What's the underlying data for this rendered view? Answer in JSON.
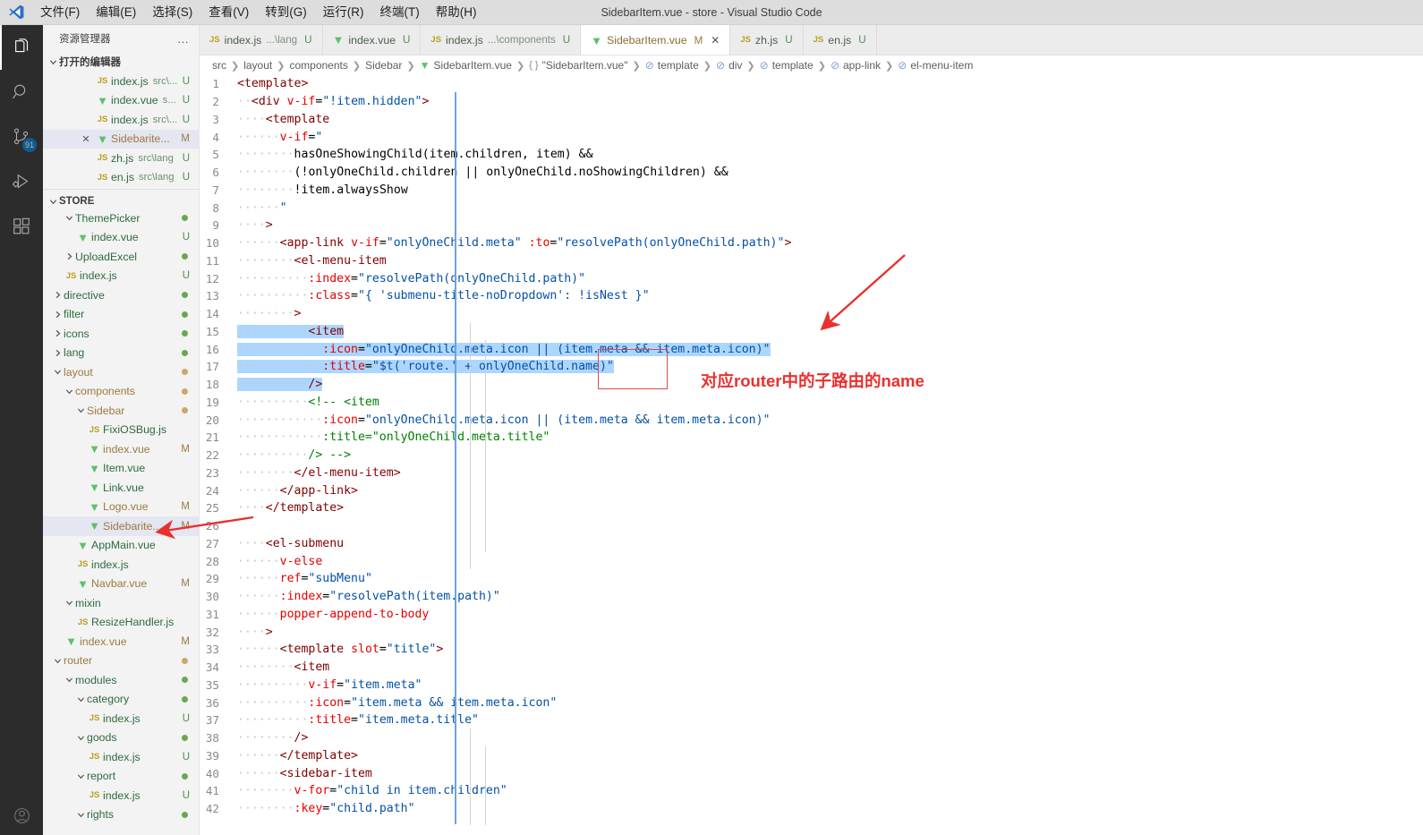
{
  "window": {
    "title": "SidebarItem.vue - store - Visual Studio Code",
    "logo_icon": "vscode-logo-icon"
  },
  "menubar": {
    "items": [
      {
        "label": "文件(F)",
        "name": "menu-file"
      },
      {
        "label": "编辑(E)",
        "name": "menu-edit"
      },
      {
        "label": "选择(S)",
        "name": "menu-selection"
      },
      {
        "label": "查看(V)",
        "name": "menu-view"
      },
      {
        "label": "转到(G)",
        "name": "menu-goto"
      },
      {
        "label": "运行(R)",
        "name": "menu-run"
      },
      {
        "label": "终端(T)",
        "name": "menu-terminal"
      },
      {
        "label": "帮助(H)",
        "name": "menu-help"
      }
    ]
  },
  "activitybar": {
    "items": [
      {
        "icon": "explorer-icon",
        "active": true,
        "badge": ""
      },
      {
        "icon": "search-icon",
        "active": false,
        "badge": ""
      },
      {
        "icon": "source-control-icon",
        "active": false,
        "badge": "91"
      },
      {
        "icon": "run-debug-icon",
        "active": false,
        "badge": ""
      },
      {
        "icon": "extensions-icon",
        "active": false,
        "badge": ""
      }
    ],
    "bottom": [
      {
        "icon": "account-icon"
      }
    ],
    "badge_color": "#007acc"
  },
  "sidebar": {
    "title": "资源管理器",
    "actions_label": "…",
    "open_editors": {
      "label": "打开的编辑器",
      "items": [
        {
          "icon": "js",
          "name": "index.js",
          "path": "src\\...",
          "status": "U",
          "selected": false,
          "indent": 3,
          "close": false
        },
        {
          "icon": "vue",
          "name": "index.vue",
          "path": "s...",
          "status": "U",
          "selected": false,
          "indent": 3,
          "close": false
        },
        {
          "icon": "js",
          "name": "index.js",
          "path": "src\\...",
          "status": "U",
          "selected": false,
          "indent": 3,
          "close": false
        },
        {
          "icon": "vue",
          "name": "Sidebarite...",
          "path": "",
          "status": "M",
          "selected": true,
          "indent": 3,
          "close": true
        },
        {
          "icon": "js",
          "name": "zh.js",
          "path": "src\\lang",
          "status": "U",
          "selected": false,
          "indent": 3,
          "close": false
        },
        {
          "icon": "js",
          "name": "en.js",
          "path": "src\\lang",
          "status": "U",
          "selected": false,
          "indent": 3,
          "close": false
        }
      ]
    },
    "store": {
      "label": "STORE",
      "items": [
        {
          "kind": "folder",
          "expanded": true,
          "name": "ThemePicker",
          "indent": 2,
          "dot": "green",
          "status": ""
        },
        {
          "kind": "file",
          "icon": "vue",
          "name": "index.vue",
          "indent": 3,
          "dot": "",
          "status": "U"
        },
        {
          "kind": "folder",
          "expanded": false,
          "name": "UploadExcel",
          "indent": 2,
          "dot": "green",
          "status": ""
        },
        {
          "kind": "file",
          "icon": "js",
          "name": "index.js",
          "indent": 2,
          "dot": "",
          "status": "U"
        },
        {
          "kind": "folder",
          "expanded": false,
          "name": "directive",
          "indent": 1,
          "dot": "green",
          "status": ""
        },
        {
          "kind": "folder",
          "expanded": false,
          "name": "filter",
          "indent": 1,
          "dot": "green",
          "status": ""
        },
        {
          "kind": "folder",
          "expanded": false,
          "name": "icons",
          "indent": 1,
          "dot": "green",
          "status": ""
        },
        {
          "kind": "folder",
          "expanded": false,
          "name": "lang",
          "indent": 1,
          "dot": "green",
          "status": ""
        },
        {
          "kind": "folder",
          "expanded": true,
          "name": "layout",
          "indent": 1,
          "dot": "amber",
          "status": "",
          "amber": true
        },
        {
          "kind": "folder",
          "expanded": true,
          "name": "components",
          "indent": 2,
          "dot": "amber",
          "status": "",
          "amber": true
        },
        {
          "kind": "folder",
          "expanded": true,
          "name": "Sidebar",
          "indent": 3,
          "dot": "amber",
          "status": "",
          "amber": true
        },
        {
          "kind": "file",
          "icon": "js",
          "name": "FixiOSBug.js",
          "indent": 4,
          "dot": "",
          "status": ""
        },
        {
          "kind": "file",
          "icon": "vue",
          "name": "index.vue",
          "indent": 4,
          "dot": "",
          "status": "M",
          "amber": true
        },
        {
          "kind": "file",
          "icon": "vue",
          "name": "Item.vue",
          "indent": 4,
          "dot": "",
          "status": ""
        },
        {
          "kind": "file",
          "icon": "vue",
          "name": "Link.vue",
          "indent": 4,
          "dot": "",
          "status": ""
        },
        {
          "kind": "file",
          "icon": "vue",
          "name": "Logo.vue",
          "indent": 4,
          "dot": "",
          "status": "M",
          "amber": true
        },
        {
          "kind": "file",
          "icon": "vue",
          "name": "Sidebarite...",
          "indent": 4,
          "dot": "",
          "status": "M",
          "amber": true,
          "selected": true
        },
        {
          "kind": "file",
          "icon": "vue",
          "name": "AppMain.vue",
          "indent": 3,
          "dot": "",
          "status": ""
        },
        {
          "kind": "file",
          "icon": "js",
          "name": "index.js",
          "indent": 3,
          "dot": "",
          "status": ""
        },
        {
          "kind": "file",
          "icon": "vue",
          "name": "Navbar.vue",
          "indent": 3,
          "dot": "",
          "status": "M",
          "amber": true
        },
        {
          "kind": "folder",
          "expanded": true,
          "name": "mixin",
          "indent": 2,
          "dot": "",
          "status": ""
        },
        {
          "kind": "file",
          "icon": "js",
          "name": "ResizeHandler.js",
          "indent": 3,
          "dot": "",
          "status": ""
        },
        {
          "kind": "file",
          "icon": "vue",
          "name": "index.vue",
          "indent": 2,
          "dot": "",
          "status": "M",
          "amber": true
        },
        {
          "kind": "folder",
          "expanded": true,
          "name": "router",
          "indent": 1,
          "dot": "amber",
          "status": "",
          "amber": true
        },
        {
          "kind": "folder",
          "expanded": true,
          "name": "modules",
          "indent": 2,
          "dot": "green",
          "status": ""
        },
        {
          "kind": "folder",
          "expanded": true,
          "name": "category",
          "indent": 3,
          "dot": "green",
          "status": ""
        },
        {
          "kind": "file",
          "icon": "js",
          "name": "index.js",
          "indent": 4,
          "dot": "",
          "status": "U"
        },
        {
          "kind": "folder",
          "expanded": true,
          "name": "goods",
          "indent": 3,
          "dot": "green",
          "status": ""
        },
        {
          "kind": "file",
          "icon": "js",
          "name": "index.js",
          "indent": 4,
          "dot": "",
          "status": "U"
        },
        {
          "kind": "folder",
          "expanded": true,
          "name": "report",
          "indent": 3,
          "dot": "green",
          "status": ""
        },
        {
          "kind": "file",
          "icon": "js",
          "name": "index.js",
          "indent": 4,
          "dot": "",
          "status": "U"
        },
        {
          "kind": "folder",
          "expanded": true,
          "name": "rights",
          "indent": 3,
          "dot": "green",
          "status": ""
        }
      ]
    }
  },
  "tabs": [
    {
      "icon": "js",
      "label": "index.js",
      "sub": "...\\lang",
      "status": "U",
      "active": false,
      "close": false
    },
    {
      "icon": "vue",
      "label": "index.vue",
      "sub": "",
      "status": "U",
      "active": false,
      "close": false
    },
    {
      "icon": "js",
      "label": "index.js",
      "sub": "...\\components",
      "status": "U",
      "active": false,
      "close": false
    },
    {
      "icon": "vue",
      "label": "SidebarItem.vue",
      "sub": "",
      "status": "M",
      "active": true,
      "close": true
    },
    {
      "icon": "js",
      "label": "zh.js",
      "sub": "",
      "status": "U",
      "active": false,
      "close": false
    },
    {
      "icon": "js",
      "label": "en.js",
      "sub": "",
      "status": "U",
      "active": false,
      "close": false
    }
  ],
  "breadcrumb": [
    {
      "label": "src",
      "icon": ""
    },
    {
      "label": "layout",
      "icon": ""
    },
    {
      "label": "components",
      "icon": ""
    },
    {
      "label": "Sidebar",
      "icon": ""
    },
    {
      "label": "SidebarItem.vue",
      "icon": "vue"
    },
    {
      "label": "\"SidebarItem.vue\"",
      "icon": "brace"
    },
    {
      "label": "template",
      "icon": "tagcircle"
    },
    {
      "label": "div",
      "icon": "tagcircle"
    },
    {
      "label": "template",
      "icon": "tagcircle"
    },
    {
      "label": "app-link",
      "icon": "tagcircle"
    },
    {
      "label": "el-menu-item",
      "icon": "tagcircle"
    }
  ],
  "code": {
    "first_line": 1,
    "last_line": 42,
    "lines": [
      {
        "n": 1,
        "text": "<template>"
      },
      {
        "n": 2,
        "text": "  <div v-if=\"!item.hidden\">"
      },
      {
        "n": 3,
        "text": "    <template"
      },
      {
        "n": 4,
        "text": "      v-if=\""
      },
      {
        "n": 5,
        "text": "        hasOneShowingChild(item.children, item) &&"
      },
      {
        "n": 6,
        "text": "        (!onlyOneChild.children || onlyOneChild.noShowingChildren) &&"
      },
      {
        "n": 7,
        "text": "        !item.alwaysShow"
      },
      {
        "n": 8,
        "text": "      \""
      },
      {
        "n": 9,
        "text": "    >"
      },
      {
        "n": 10,
        "text": "      <app-link v-if=\"onlyOneChild.meta\" :to=\"resolvePath(onlyOneChild.path)\">"
      },
      {
        "n": 11,
        "text": "        <el-menu-item"
      },
      {
        "n": 12,
        "text": "          :index=\"resolvePath(onlyOneChild.path)\""
      },
      {
        "n": 13,
        "text": "          :class=\"{ 'submenu-title-noDropdown': !isNest }\""
      },
      {
        "n": 14,
        "text": "        >"
      },
      {
        "n": 15,
        "text": "          <item",
        "selected": true
      },
      {
        "n": 16,
        "text": "            :icon=\"onlyOneChild.meta.icon || (item.meta && item.meta.icon)\"",
        "selected": true
      },
      {
        "n": 17,
        "text": "            :title=\"$t('route.' + onlyOneChild.name)\"",
        "selected": true
      },
      {
        "n": 18,
        "text": "          />",
        "selected": true
      },
      {
        "n": 19,
        "text": "          <!-- <item"
      },
      {
        "n": 20,
        "text": "            :icon=\"onlyOneChild.meta.icon || (item.meta && item.meta.icon)\""
      },
      {
        "n": 21,
        "text": "            :title=\"onlyOneChild.meta.title\""
      },
      {
        "n": 22,
        "text": "          /> -->"
      },
      {
        "n": 23,
        "text": "        </el-menu-item>"
      },
      {
        "n": 24,
        "text": "      </app-link>"
      },
      {
        "n": 25,
        "text": "    </template>"
      },
      {
        "n": 26,
        "text": ""
      },
      {
        "n": 27,
        "text": "    <el-submenu"
      },
      {
        "n": 28,
        "text": "      v-else"
      },
      {
        "n": 29,
        "text": "      ref=\"subMenu\""
      },
      {
        "n": 30,
        "text": "      :index=\"resolvePath(item.path)\""
      },
      {
        "n": 31,
        "text": "      popper-append-to-body"
      },
      {
        "n": 32,
        "text": "    >"
      },
      {
        "n": 33,
        "text": "      <template slot=\"title\">"
      },
      {
        "n": 34,
        "text": "        <item"
      },
      {
        "n": 35,
        "text": "          v-if=\"item.meta\""
      },
      {
        "n": 36,
        "text": "          :icon=\"item.meta && item.meta.icon\""
      },
      {
        "n": 37,
        "text": "          :title=\"item.meta.title\""
      },
      {
        "n": 38,
        "text": "        />"
      },
      {
        "n": 39,
        "text": "      </template>"
      },
      {
        "n": 40,
        "text": "      <sidebar-item"
      },
      {
        "n": 41,
        "text": "        v-for=\"child in item.children\""
      },
      {
        "n": 42,
        "text": "        :key=\"child.path\""
      }
    ]
  },
  "annotations": {
    "note_text": "对应router中的子路由的name",
    "color": "#e8312f",
    "box_color": "#d2504e",
    "arrow_editor": "arrow-pointing-to-item-tag",
    "arrow_sidebar": "arrow-pointing-to-sidebaritem-file"
  },
  "colors": {
    "selection_blue": "#add6ff",
    "accent_blue": "#007acc",
    "tag_maroon": "#800000",
    "attr_red": "#e50000",
    "string_blue": "#0451a5",
    "comment_green": "#008000"
  }
}
